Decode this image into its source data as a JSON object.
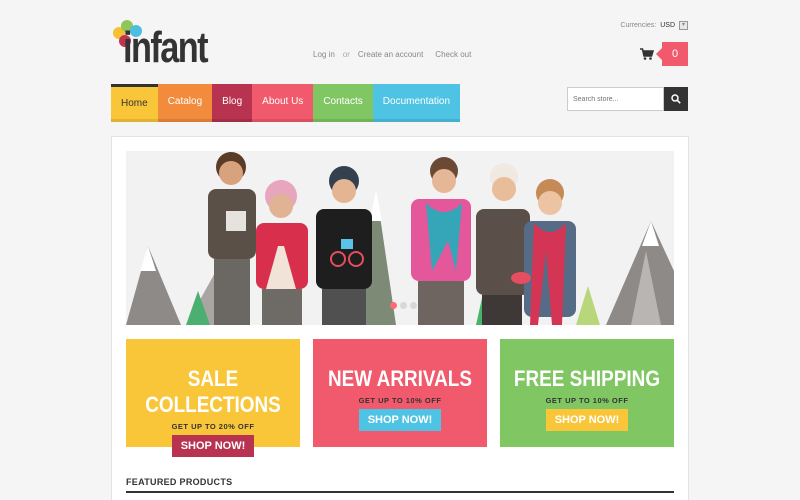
{
  "brand": {
    "name": "infant"
  },
  "top_links": {
    "login": "Log in",
    "or": "or",
    "create": "Create an account",
    "checkout": "Check out"
  },
  "currency": {
    "label": "Currencies:",
    "value": "USD"
  },
  "cart": {
    "count": "0"
  },
  "nav": [
    {
      "label": "Home",
      "color": "#f9c63a",
      "active": true
    },
    {
      "label": "Catalog",
      "color": "#f38b3c",
      "active": false
    },
    {
      "label": "Blog",
      "color": "#b7334f",
      "active": false
    },
    {
      "label": "About Us",
      "color": "#f15a6c",
      "active": false
    },
    {
      "label": "Contacts",
      "color": "#80c764",
      "active": false
    },
    {
      "label": "Documentation",
      "color": "#4fc3e3",
      "active": false
    }
  ],
  "search": {
    "placeholder": "Search store..."
  },
  "slider": {
    "slide_count": 3,
    "active_index": 0
  },
  "promos": [
    {
      "title": "SALE COLLECTIONS",
      "subtitle": "GET UP TO 20% OFF",
      "button": "SHOP NOW!",
      "bg": "#f9c63a",
      "btn_color": "#b7334f"
    },
    {
      "title": "NEW ARRIVALS",
      "subtitle": "GET UP TO 10% OFF",
      "button": "SHOP NOW!",
      "bg": "#f15a6c",
      "btn_color": "#4fc3e3"
    },
    {
      "title": "FREE SHIPPING",
      "subtitle": "GET UP TO 10% OFF",
      "button": "SHOP NOW!",
      "bg": "#80c764",
      "btn_color": "#f9c63a"
    }
  ],
  "featured": {
    "title": "FEATURED PRODUCTS"
  }
}
